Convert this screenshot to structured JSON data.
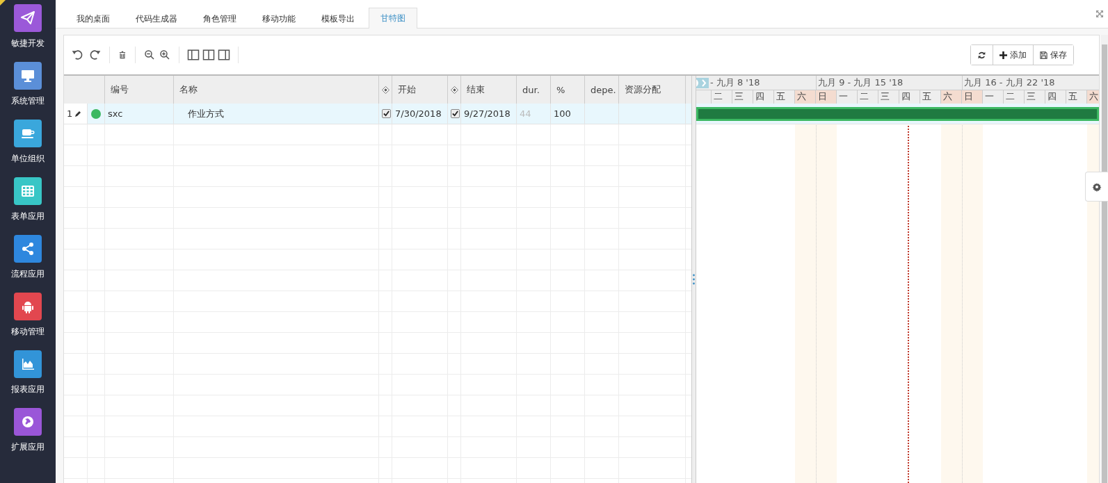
{
  "sidebar": {
    "items": [
      {
        "label": "敏捷开发",
        "color": "#9b59d9"
      },
      {
        "label": "系统管理",
        "color": "#5b8fd8"
      },
      {
        "label": "单位组织",
        "color": "#3aa7dc"
      },
      {
        "label": "表单应用",
        "color": "#38c6c6"
      },
      {
        "label": "流程应用",
        "color": "#2e87de"
      },
      {
        "label": "移动管理",
        "color": "#e2474f"
      },
      {
        "label": "报表应用",
        "color": "#3294d8"
      },
      {
        "label": "扩展应用",
        "color": "#9a56d8"
      }
    ]
  },
  "tabs": [
    {
      "label": "我的桌面",
      "selected": false
    },
    {
      "label": "代码生成器",
      "selected": false
    },
    {
      "label": "角色管理",
      "selected": false
    },
    {
      "label": "移动功能",
      "selected": false
    },
    {
      "label": "模板导出",
      "selected": false
    },
    {
      "label": "甘特图",
      "selected": true
    }
  ],
  "toolbar": {
    "actions": [
      {
        "label": "添加"
      },
      {
        "label": "保存"
      }
    ]
  },
  "grid": {
    "columns": [
      {
        "label": "编号",
        "kind": "code"
      },
      {
        "label": "名称",
        "kind": "name"
      },
      {
        "label": "开始",
        "kind": "date"
      },
      {
        "label": "结束",
        "kind": "date"
      },
      {
        "label": "dur.",
        "kind": "duration"
      },
      {
        "label": "%",
        "kind": "progress"
      },
      {
        "label": "depe.",
        "kind": "dependency"
      },
      {
        "label": "资源分配",
        "kind": "resource"
      }
    ],
    "rows": [
      {
        "number": "1",
        "color": "#3cb862",
        "cells": [
          {
            "text": "sxc"
          },
          {
            "text": "作业方式"
          },
          {
            "text": "7/30/2018",
            "checked": true
          },
          {
            "text": "9/27/2018",
            "checked": true
          },
          {
            "text": "44"
          },
          {
            "text": "100"
          }
        ]
      }
    ]
  },
  "gantt": {
    "weeks": [
      {
        "label": "- 九月 8 '18",
        "days": [
          {
            "label": "二",
            "weekend": false,
            "today": false
          },
          {
            "label": "三",
            "weekend": false,
            "today": false
          },
          {
            "label": "四",
            "weekend": false,
            "today": false
          },
          {
            "label": "五",
            "weekend": false,
            "today": false
          },
          {
            "label": "六",
            "weekend": true,
            "today": false
          }
        ]
      },
      {
        "label": "九月 9 - 九月 15 '18",
        "days": [
          {
            "label": "日",
            "weekend": true,
            "today": false
          },
          {
            "label": "一",
            "weekend": false,
            "today": false
          },
          {
            "label": "二",
            "weekend": false,
            "today": false
          },
          {
            "label": "三",
            "weekend": false,
            "today": false
          },
          {
            "label": "四",
            "weekend": false,
            "today": true
          },
          {
            "label": "五",
            "weekend": false,
            "today": false
          },
          {
            "label": "六",
            "weekend": true,
            "today": false
          }
        ]
      },
      {
        "label": "九月 16 - 九月 22 '18",
        "days": [
          {
            "label": "日",
            "weekend": true,
            "today": false
          },
          {
            "label": "一",
            "weekend": false,
            "today": false
          },
          {
            "label": "二",
            "weekend": false,
            "today": false
          },
          {
            "label": "三",
            "weekend": false,
            "today": false
          },
          {
            "label": "四",
            "weekend": false,
            "today": false
          },
          {
            "label": "五",
            "weekend": false,
            "today": false
          },
          {
            "label": "六",
            "weekend": true,
            "today": false
          }
        ]
      }
    ]
  }
}
